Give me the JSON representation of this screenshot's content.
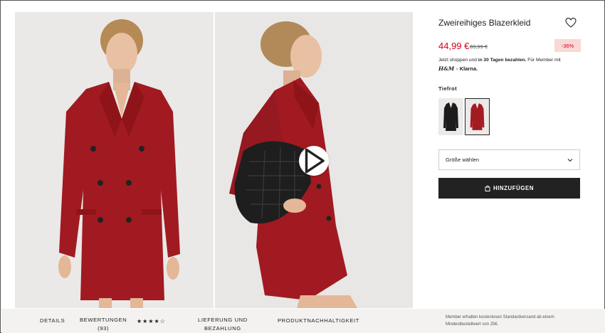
{
  "product": {
    "title": "Zweireihiges Blazerkleid",
    "price": "44,99 €",
    "old_price": "69,99 €",
    "discount": "-36%",
    "klarna_prefix": "Jetzt shoppen und ",
    "klarna_bold": "in 30 Tagen bezahlen.",
    "klarna_suffix": " Für Member mit",
    "brand_logo": "H&M",
    "klarna_x": "×",
    "klarna_name": "Klarna.",
    "color_name": "Tiefrot",
    "size_placeholder": "Größe wählen",
    "add_label": "HINZUFÜGEN",
    "colors": {
      "selected": "#a41b22",
      "alternate": "#1c1c1c",
      "price": "#d6001c"
    }
  },
  "icons": {
    "heart": "heart-icon",
    "play": "play-icon",
    "chevron": "chevron-down-icon",
    "bag": "shopping-bag-icon"
  },
  "bottom": {
    "details": "DETAILS",
    "reviews_line1": "BEWERTUNGEN",
    "reviews_line2": "(93)",
    "stars": "★★★★☆",
    "delivery_line1": "LIEFERUNG UND",
    "delivery_line2": "BEZAHLUNG",
    "sustainability": "PRODUKTNACHHALTIGKEIT",
    "member_note": "Member erhalten kostenlosen Standardversand ab einem Mindestbestellwert von 25€."
  }
}
